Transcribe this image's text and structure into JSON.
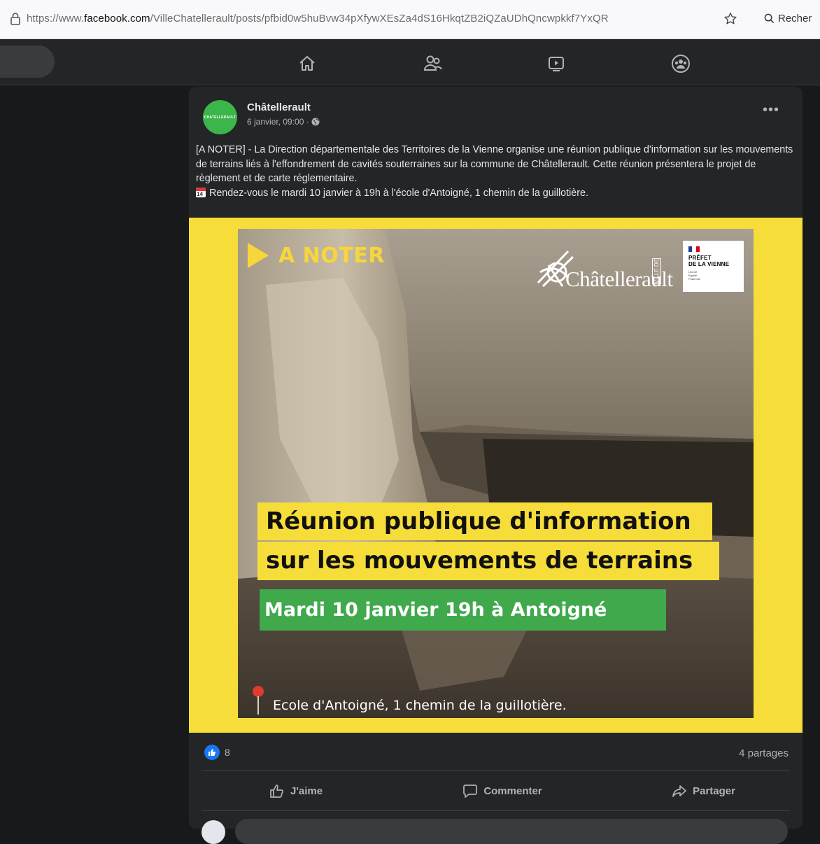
{
  "browser": {
    "url_prefix": "https://www.",
    "url_domain": "facebook.com",
    "url_path": "/VilleChatellerault/posts/pfbid0w5huBvw34pXfywXEsZa4dS16HkqtZB2iQZaUDhQncwpkkf7YxQR",
    "search_label": "Recher"
  },
  "nav": {
    "icons": [
      "home-icon",
      "friends-icon",
      "watch-icon",
      "groups-icon"
    ]
  },
  "post": {
    "avatar_text": "CHATELLERAULT",
    "author": "Châtellerault",
    "timestamp": "6 janvier, 09:00 ·",
    "more_label": "•••",
    "text_lines": [
      "[A NOTER] - La Direction départementale des Territoires de la Vienne organise une réunion publique d'information sur les mouvements de terrains liés à l'effondrement de cavités souterraines sur la commune de Châtellerault. Cette réunion présentera le projet de règlement et de carte réglementaire."
    ],
    "calendar_day": "14",
    "rdv_line": "Rendez-vous le mardi 10 janvier à 19h à l'école d'Antoigné, 1 chemin de la guillotière."
  },
  "poster": {
    "tag": "A NOTER",
    "logo_text": "Châtellerault",
    "logo_ville": "VILLE DE",
    "prefet_lines": "PRÉFET\nDE LA VIENNE",
    "prefet_sub": "Liberté\nÉgalité\nFraternité",
    "headline_1": "Réunion publique d'information",
    "headline_2": "sur les mouvements de terrains",
    "date_line": "Mardi 10 janvier 19h à Antoigné",
    "location": "Ecole d'Antoigné, 1 chemin de la guillotière.",
    "colors": {
      "yellow": "#f7dd3a",
      "green": "#3fa94c"
    }
  },
  "stats": {
    "likes": "8",
    "shares": "4 partages"
  },
  "actions": {
    "like": "J'aime",
    "comment": "Commenter",
    "share": "Partager"
  }
}
